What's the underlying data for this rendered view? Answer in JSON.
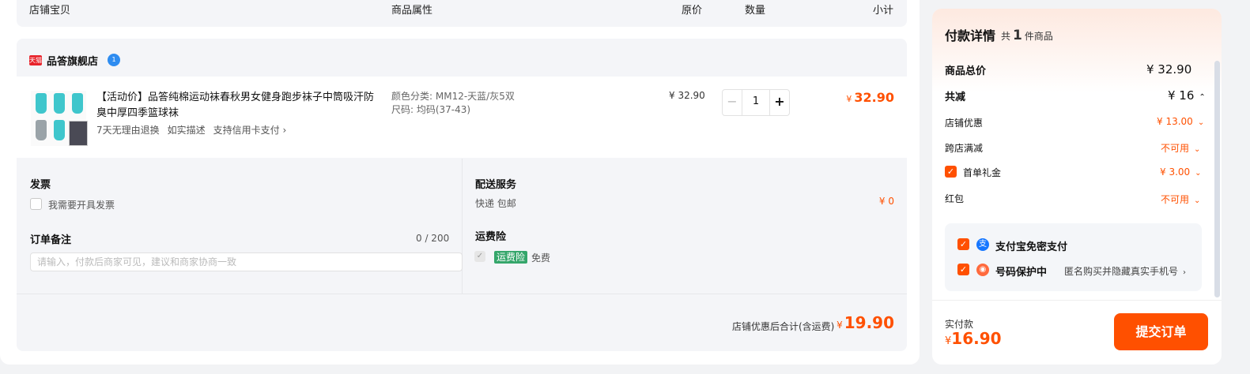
{
  "columns": [
    "店铺宝贝",
    "商品属性",
    "原价",
    "数量",
    "小计"
  ],
  "shop": {
    "badge": "天猫",
    "name": "品答旗舰店",
    "chat_badge": "1"
  },
  "item": {
    "title": "【活动价】品答纯棉运动袜春秋男女健身跑步袜子中筒吸汗防臭中厚四季篮球袜",
    "tags": [
      "7天无理由退换",
      "如实描述",
      "支持信用卡支付 ›"
    ],
    "attrs": [
      "颜色分类: MM12-天蓝/灰5双",
      "尺码: 均码(37-43)"
    ],
    "unit_price": "¥ 32.90",
    "quantity": "1",
    "minus": "−",
    "plus": "+",
    "subtotal_symbol": "¥",
    "subtotal": "32.90"
  },
  "invoice": {
    "title": "发票",
    "checkbox_label": "我需要开具发票"
  },
  "note": {
    "title": "订单备注",
    "counter": "0 / 200",
    "placeholder": "请输入，付款后商家可见，建议和商家协商一致"
  },
  "delivery": {
    "title": "配送服务",
    "desc": "快递 包邮",
    "fee": "¥ 0"
  },
  "insurance": {
    "title": "运费险",
    "tag": "运费险",
    "desc": "免费"
  },
  "shop_total": {
    "label": "店铺优惠后合计(含运费)",
    "symbol": "¥",
    "amount": "19.90"
  },
  "payment": {
    "title": "付款详情",
    "count_prefix": "共",
    "count": "1",
    "count_suffix": "件商品",
    "rows": {
      "goods_total": {
        "label": "商品总价",
        "value": "¥ 32.90"
      },
      "total_discount": {
        "label": "共减",
        "value": "¥ 16"
      },
      "store_coupon": {
        "label": "店铺优惠",
        "value": "¥ 13.00"
      },
      "cross_store": {
        "label": "跨店满减",
        "value": "不可用"
      },
      "first_order": {
        "label": "首单礼金",
        "value": "¥ 3.00"
      },
      "red_packet": {
        "label": "红包",
        "value": "不可用"
      }
    },
    "alipay": "支付宝免密支付",
    "number_protect": "号码保护中",
    "number_protect_desc": "匿名购买并隐藏真实手机号",
    "actual_label": "实付款",
    "actual_symbol": "¥",
    "actual_amount": "16.90",
    "submit": "提交订单"
  },
  "colors": {
    "accent": "#ff5000",
    "panel": "#f4f5f8",
    "tag_green": "#35a66b"
  }
}
